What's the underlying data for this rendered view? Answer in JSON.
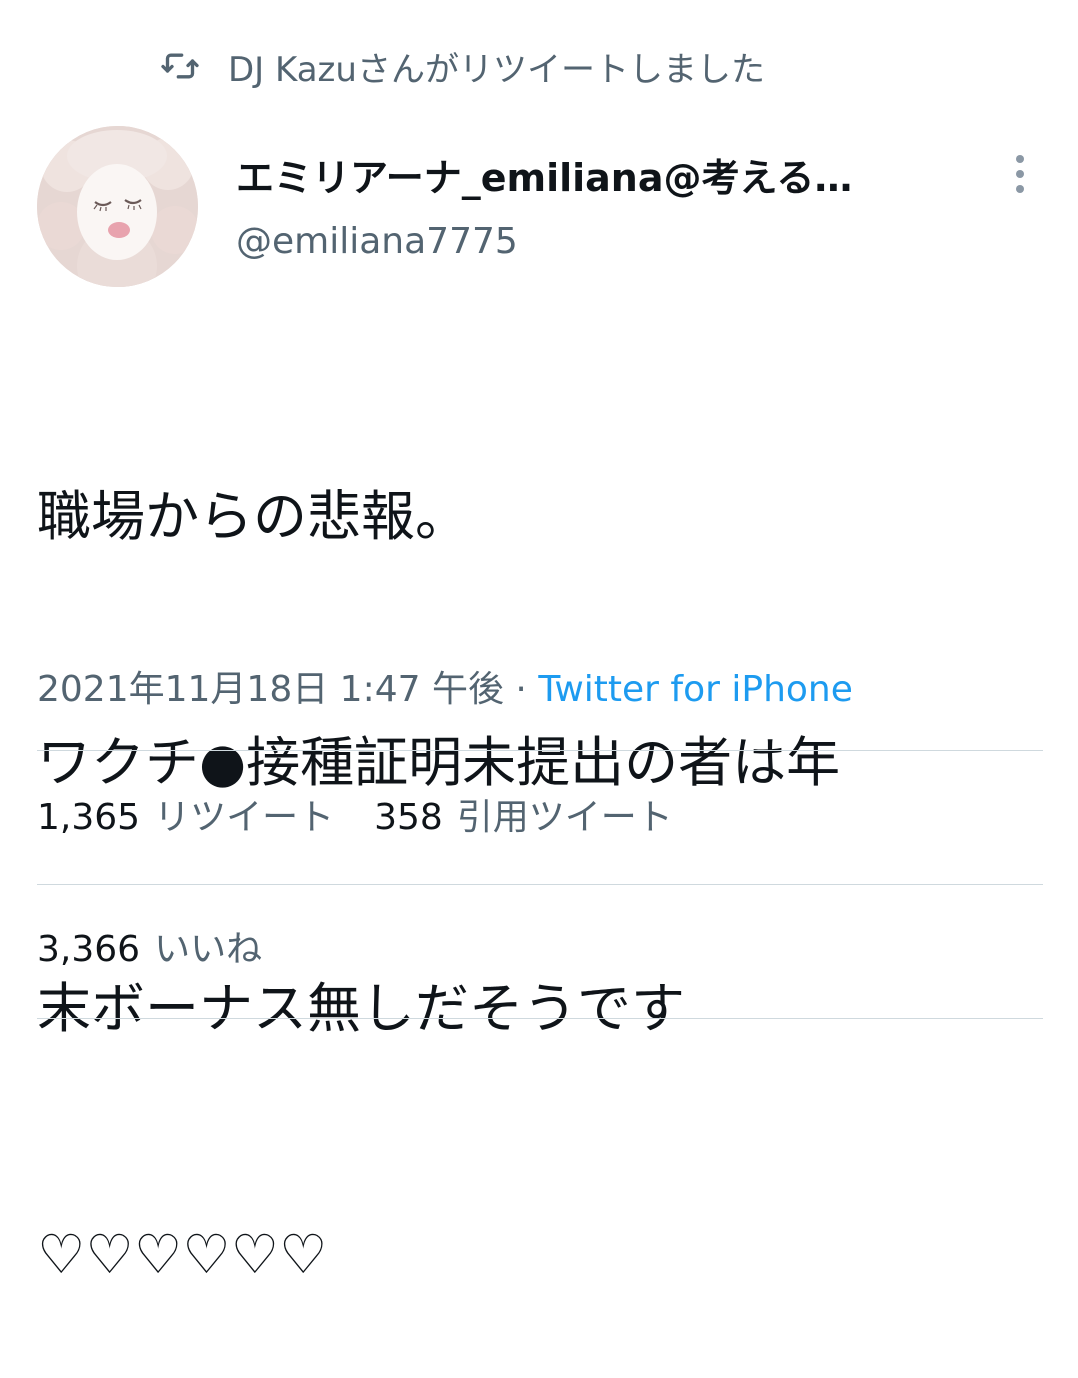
{
  "retweet_context": {
    "icon": "retweet-icon",
    "text": "DJ Kazuさんがリツイートしました"
  },
  "author": {
    "avatar": "plush-sheep-avatar",
    "display_name": "エミリアーナ_emiliana@考える…",
    "handle": "@emiliana7775"
  },
  "more_icon": "more-vertical-icon",
  "tweet": {
    "lines": [
      "職場からの悲報。",
      "ワクチ●接種証明未提出の者は年",
      "末ボーナス無しだそうです",
      "♡♡♡♡♡♡"
    ],
    "timestamp": "2021年11月18日 1:47 午後",
    "separator": " · ",
    "source": "Twitter for iPhone"
  },
  "stats": {
    "retweets_count": "1,365",
    "retweets_label": "リツイート",
    "quotes_count": "358",
    "quotes_label": "引用ツイート",
    "likes_count": "3,366",
    "likes_label": "いいね"
  },
  "colors": {
    "text_primary": "#0f1419",
    "text_secondary": "#536471",
    "link": "#1d9bf0",
    "divider": "#cfd9de"
  }
}
